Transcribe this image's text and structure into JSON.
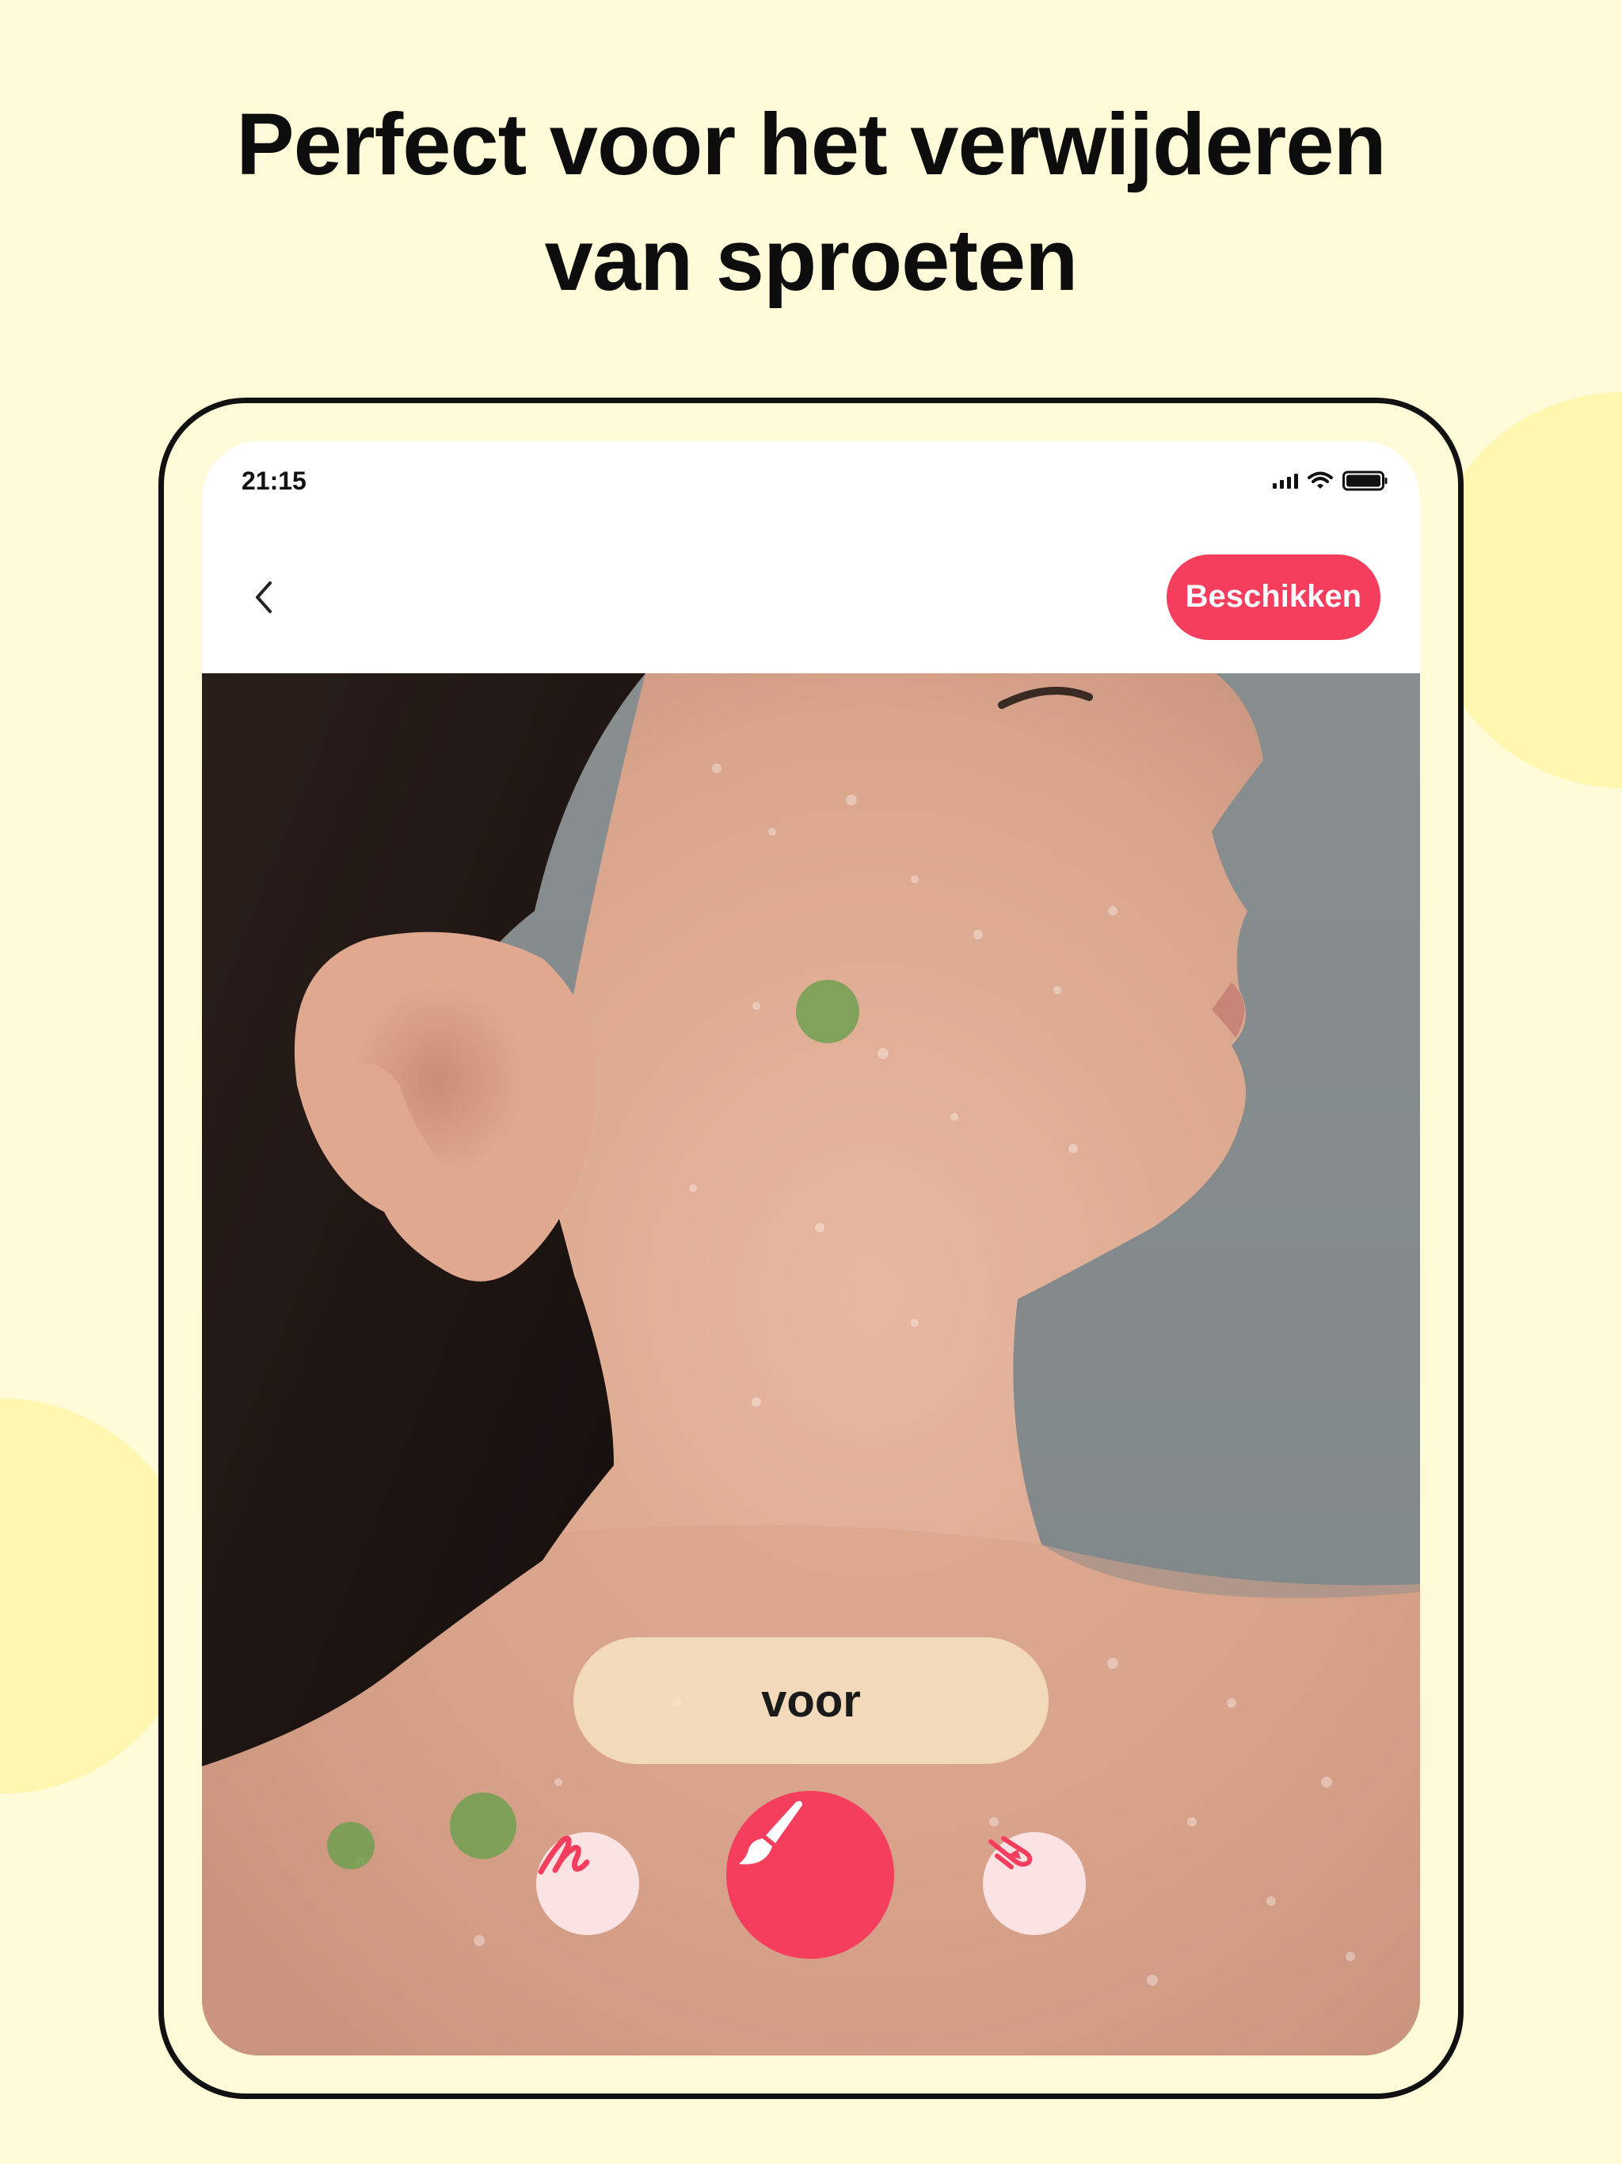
{
  "headline": {
    "line1": "Perfect voor het verwijderen",
    "line2": "van sproeten"
  },
  "status_bar": {
    "time": "21:15",
    "icons": [
      "signal-icon",
      "wifi-icon",
      "battery-icon"
    ]
  },
  "nav": {
    "back_icon": "chevron-left-icon",
    "apply_label": "Beschikken"
  },
  "canvas": {
    "before_label": "voor",
    "marker_color": "#6ea050"
  },
  "toolbar": {
    "tools": [
      {
        "name": "draw-tool",
        "icon": "scribble-icon"
      },
      {
        "name": "brush-tool",
        "icon": "paintbrush-icon",
        "selected": true
      },
      {
        "name": "eraser-tool",
        "icon": "eraser-icon"
      }
    ]
  },
  "colors": {
    "background": "#fffbd9",
    "accent": "#f53d5e",
    "tool_bg": "#fbe3e4"
  }
}
